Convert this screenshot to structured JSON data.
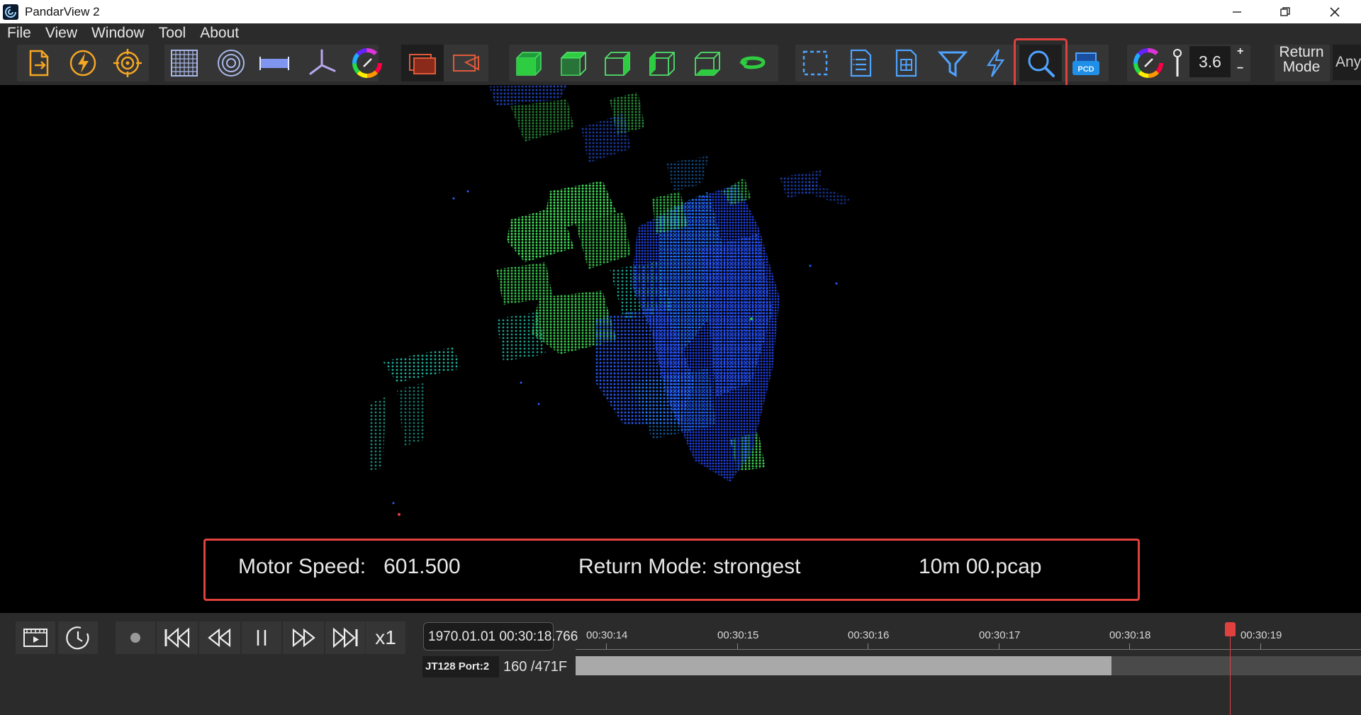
{
  "window": {
    "title": "PandarView 2"
  },
  "menu": [
    "File",
    "View",
    "Window",
    "Tool",
    "About"
  ],
  "toolbar": {
    "point_size": "3.6",
    "plus": "+",
    "minus": "−",
    "return_mode_label": "Return\nMode",
    "return_mode_value": "Any",
    "highlighted_tool": "search-icon"
  },
  "info": {
    "motor_speed": "Motor Speed:   601.500",
    "return_mode": "Return Mode: strongest",
    "file": "10m 00.pcap"
  },
  "playback": {
    "speed": "x1",
    "timestamp": "1970.01.01 00:30:18.766",
    "port": "JT128 Port:2",
    "frame": "160  /471F",
    "progress": 0.682,
    "ticks": [
      "00:30:14",
      "00:30:15",
      "00:30:16",
      "00:30:17",
      "00:30:18",
      "00:30:19"
    ]
  },
  "colors": {
    "accent_red": "#e0413f",
    "toolbar_bg": "#2b2b2b",
    "icon_orange": "#f5a623",
    "icon_blue": "#4fa3ff",
    "icon_green": "#2ecc40"
  }
}
